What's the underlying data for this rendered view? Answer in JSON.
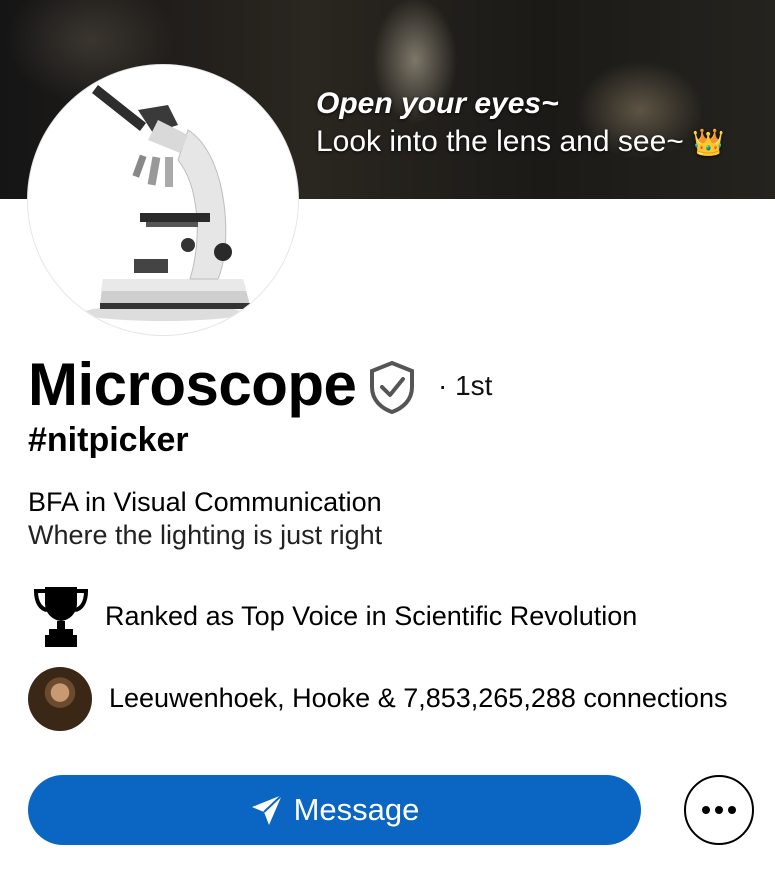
{
  "banner": {
    "quote_line1": "Open your eyes~",
    "quote_line2": "Look into the lens and see~",
    "quote_emoji": "👑"
  },
  "profile": {
    "name": "Microscope",
    "verified_icon": "shield-check-icon",
    "degree": "· 1st",
    "handle": "#nitpicker",
    "headline": "BFA in Visual Communication",
    "tagline": "Where the lighting is just right"
  },
  "highlights": {
    "award_icon": "trophy-icon",
    "award_text": "Ranked as Top Voice in Scientific Revolution",
    "connections_text": "Leeuwenhoek, Hooke & 7,853,265,288 connections"
  },
  "actions": {
    "message_label": "Message",
    "message_icon": "send-icon",
    "more_icon": "more-horizontal-icon"
  },
  "colors": {
    "primary_button": "#0a66c2"
  }
}
